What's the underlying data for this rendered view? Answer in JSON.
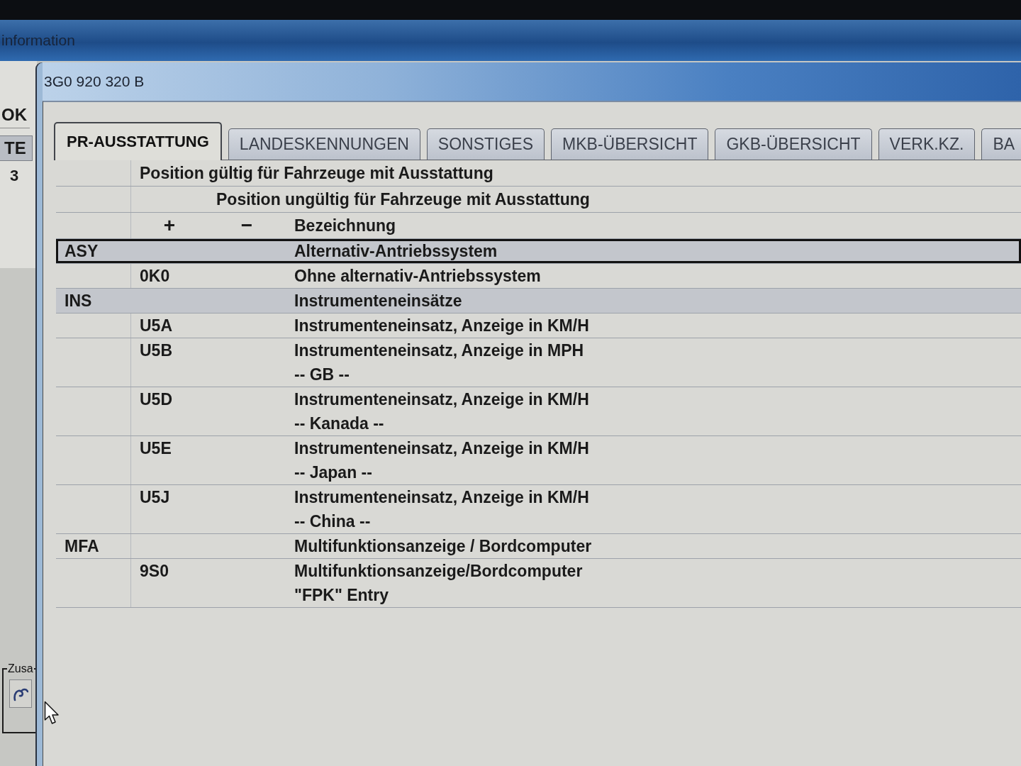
{
  "background_window": {
    "title": "information",
    "column_header": "OK",
    "tab": "TE",
    "cell": "3",
    "group_label": "Zusa"
  },
  "dialog": {
    "title": "3G0 920 320 B",
    "tabs": [
      {
        "label": "PR-AUSSTATTUNG",
        "selected": true
      },
      {
        "label": "LANDESKENNUNGEN",
        "selected": false
      },
      {
        "label": "SONSTIGES",
        "selected": false
      },
      {
        "label": "MKB-ÜBERSICHT",
        "selected": false
      },
      {
        "label": "GKB-ÜBERSICHT",
        "selected": false
      },
      {
        "label": "VERK.KZ.",
        "selected": false
      },
      {
        "label": "BA",
        "selected": false
      }
    ],
    "table": {
      "header_lines": [
        "Position gültig für Fahrzeuge mit Ausstattung",
        "Position ungültig für Fahrzeuge mit Ausstattung"
      ],
      "columns": [
        "+",
        "−",
        "Bezeichnung"
      ],
      "rows": [
        {
          "kind": "family",
          "code": "ASY",
          "lines": [
            "Alternativ-Antriebssystem"
          ],
          "selected": true,
          "highlighted": true
        },
        {
          "kind": "option",
          "code": "0K0",
          "lines": [
            "Ohne alternativ-Antriebssystem"
          ],
          "selected": false,
          "highlighted": false
        },
        {
          "kind": "family",
          "code": "INS",
          "lines": [
            "Instrumenteneinsätze"
          ],
          "selected": false,
          "highlighted": true
        },
        {
          "kind": "option",
          "code": "U5A",
          "lines": [
            "Instrumenteneinsatz, Anzeige in KM/H"
          ],
          "selected": false,
          "highlighted": false
        },
        {
          "kind": "option",
          "code": "U5B",
          "lines": [
            "Instrumenteneinsatz, Anzeige in MPH",
            "-- GB --"
          ],
          "selected": false,
          "highlighted": false
        },
        {
          "kind": "option",
          "code": "U5D",
          "lines": [
            "Instrumenteneinsatz, Anzeige in KM/H",
            "-- Kanada --"
          ],
          "selected": false,
          "highlighted": false
        },
        {
          "kind": "option",
          "code": "U5E",
          "lines": [
            "Instrumenteneinsatz, Anzeige in KM/H",
            "-- Japan --"
          ],
          "selected": false,
          "highlighted": false
        },
        {
          "kind": "option",
          "code": "U5J",
          "lines": [
            "Instrumenteneinsatz, Anzeige in KM/H",
            "-- China --"
          ],
          "selected": false,
          "highlighted": false
        },
        {
          "kind": "family",
          "code": "MFA",
          "lines": [
            "Multifunktionsanzeige / Bordcomputer"
          ],
          "selected": false,
          "highlighted": false
        },
        {
          "kind": "option",
          "code": "9S0",
          "lines": [
            "Multifunktionsanzeige/Bordcomputer",
            "\"FPK\" Entry"
          ],
          "selected": false,
          "highlighted": false
        }
      ]
    }
  }
}
